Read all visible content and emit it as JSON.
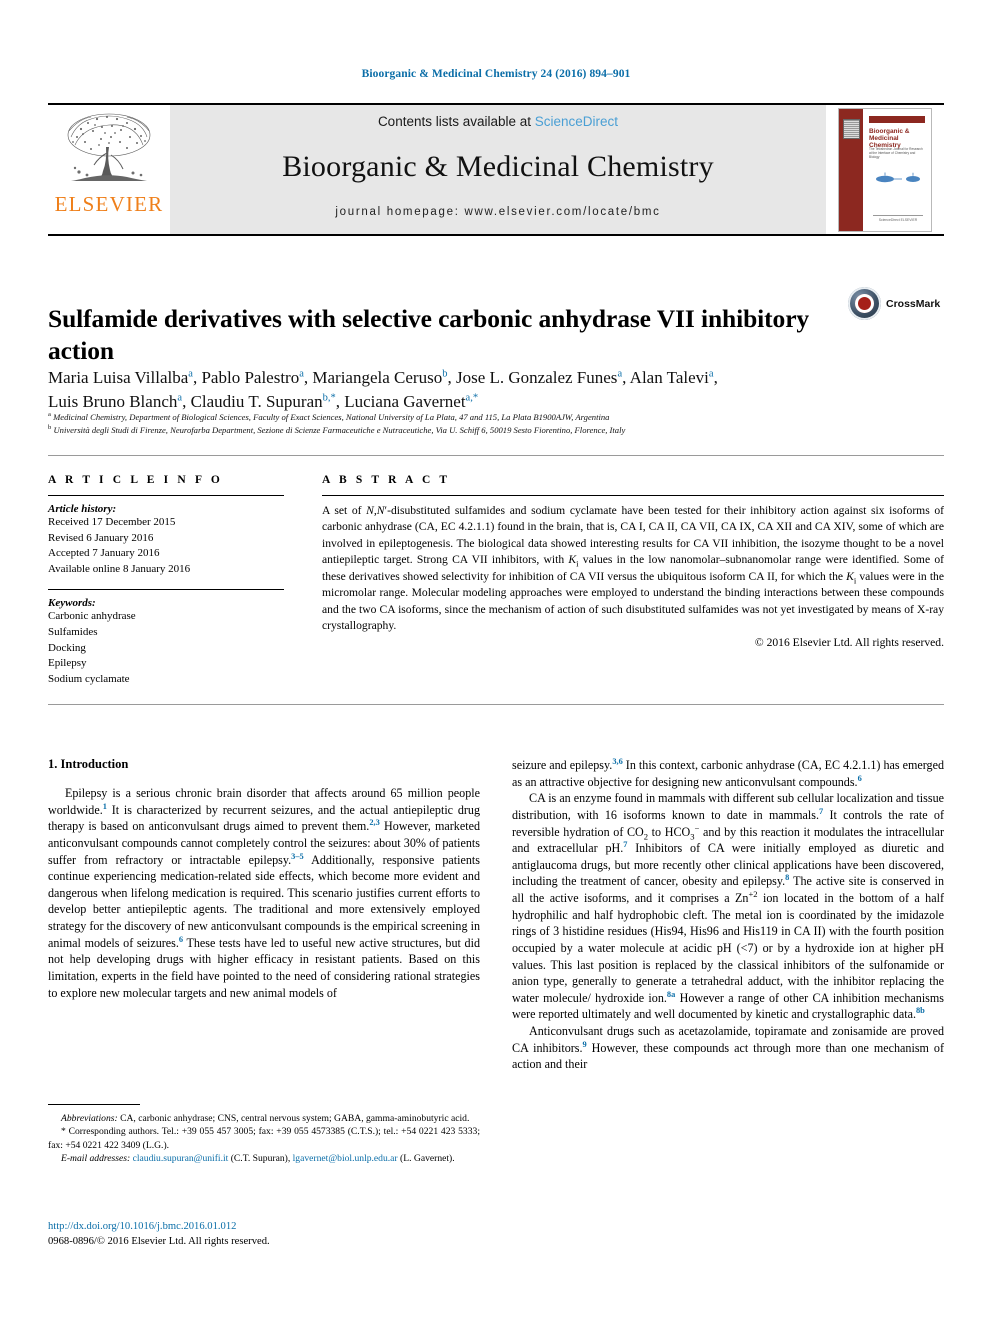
{
  "running_head": "Bioorganic & Medicinal Chemistry 24 (2016) 894–901",
  "masthead": {
    "contents_prefix": "Contents lists available at ",
    "sciencedirect": "ScienceDirect",
    "journal_title": "Bioorganic & Medicinal Chemistry",
    "homepage": "journal homepage: www.elsevier.com/locate/bmc",
    "publisher_logo_word": "ELSEVIER",
    "cover": {
      "title": "Bioorganic & Medicinal Chemistry",
      "subtitle": "The Tetrahedron Journal for Research at the Interface of Chemistry and Biology",
      "footer": "ScienceDirect  ELSEVIER"
    }
  },
  "article": {
    "title": "Sulfamide derivatives with selective carbonic anhydrase VII inhibitory action",
    "crossmark_label": "CrossMark",
    "authors_line1": "Maria Luisa Villalba a, Pablo Palestro a, Mariangela Ceruso b, Jose L. Gonzalez Funes a, Alan Talevi a,",
    "authors_line2": "Luis Bruno Blanch a, Claudiu T. Supuran b,*, Luciana Gavernet a,*",
    "authors": [
      {
        "name": "Maria Luisa Villalba",
        "mark": "a"
      },
      {
        "name": "Pablo Palestro",
        "mark": "a"
      },
      {
        "name": "Mariangela Ceruso",
        "mark": "b"
      },
      {
        "name": "Jose L. Gonzalez Funes",
        "mark": "a"
      },
      {
        "name": "Alan Talevi",
        "mark": "a"
      },
      {
        "name": "Luis Bruno Blanch",
        "mark": "a"
      },
      {
        "name": "Claudiu T. Supuran",
        "mark": "b,*"
      },
      {
        "name": "Luciana Gavernet",
        "mark": "a,*"
      }
    ],
    "affiliations": [
      {
        "mark": "a",
        "text": "Medicinal Chemistry, Department of Biological Sciences, Faculty of Exact Sciences, National University of La Plata, 47 and 115, La Plata B1900AJW, Argentina"
      },
      {
        "mark": "b",
        "text": "Università degli Studi di Firenze, Neurofarba Department, Sezione di Scienze Farmaceutiche e Nutraceutiche, Via U. Schiff 6, 50019 Sesto Fiorentino, Florence, Italy"
      }
    ]
  },
  "article_info": {
    "heading": "A R T I C L E   I N F O",
    "history_label": "Article history:",
    "history": [
      "Received 17 December 2015",
      "Revised 6 January 2016",
      "Accepted 7 January 2016",
      "Available online 8 January 2016"
    ],
    "keywords_label": "Keywords:",
    "keywords": [
      "Carbonic anhydrase",
      "Sulfamides",
      "Docking",
      "Epilepsy",
      "Sodium cyclamate"
    ]
  },
  "abstract": {
    "heading": "A B S T R A C T",
    "part1": "A set of ",
    "italic1": "N,N",
    "part2": "′-disubstituted sulfamides and sodium cyclamate have been tested for their inhibitory action against six isoforms of carbonic anhydrase (CA, EC 4.2.1.1) found in the brain, that is, CA I, CA II, CA VII, CA IX, CA XII and CA XIV, some of which are involved in epileptogenesis. The biological data showed interesting results for CA VII inhibition, the isozyme thought to be a novel antiepileptic target. Strong CA VII inhibitors, with ",
    "italic2": "K",
    "sub2": "i",
    "part3": " values in the low nanomolar–subnanomolar range were identified. Some of these derivatives showed selectivity for inhibition of CA VII versus the ubiquitous isoform CA II, for which the ",
    "italic3": "K",
    "sub3": "i",
    "part4": " values were in the micromolar range. Molecular modeling approaches were employed to understand the binding interactions between these compounds and the two CA isoforms, since the mechanism of action of such disubstituted sulfamides was not yet investigated by means of X-ray crystallography.",
    "copyright": "© 2016 Elsevier Ltd. All rights reserved."
  },
  "body": {
    "section_heading": "1. Introduction",
    "left_p1_a": "Epilepsy is a serious chronic brain disorder that affects around 65 million people worldwide.",
    "left_p1_r1": "1",
    "left_p1_b": " It is characterized by recurrent seizures, and the actual antiepileptic drug therapy is based on anticonvulsant drugs aimed to prevent them.",
    "left_p1_r2": "2,3",
    "left_p1_c": " However, marketed anticonvulsant compounds cannot completely control the seizures: about 30% of patients suffer from refractory or intractable epilepsy.",
    "left_p1_r3": "3–5",
    "left_p1_d": " Additionally, responsive patients continue experiencing medication-related side effects, which become more evident and dangerous when lifelong medication is required. This scenario justifies current efforts to develop better antiepileptic agents. The traditional and more extensively employed strategy for the discovery of new anticonvulsant compounds is the empirical screening in animal models of seizures.",
    "left_p1_r4": "6",
    "left_p1_e": " These tests have led to useful new active structures, but did not help developing drugs with higher efficacy in resistant patients. Based on this limitation, experts in the field have pointed to the need of considering rational strategies to explore new molecular targets and new animal models of",
    "right_p1_a": "seizure and epilepsy.",
    "right_p1_r1": "3,6",
    "right_p1_b": " In this context, carbonic anhydrase (CA, EC 4.2.1.1) has emerged as an attractive objective for designing new anticonvulsant compounds.",
    "right_p1_r2": "6",
    "right_p2_a": "CA is an enzyme found in mammals with different sub cellular localization and tissue distribution, with 16 isoforms known to date in mammals.",
    "right_p2_r1": "7",
    "right_p2_b": " It controls the rate of reversible hydration of CO",
    "right_p2_sub1": "2",
    "right_p2_c": " to HCO",
    "right_p2_sub2": "3",
    "right_p2_sup2": "−",
    "right_p2_d": " and by this reaction it modulates the intracellular and extracellular pH.",
    "right_p2_r2": "7",
    "right_p2_e": " Inhibitors of CA were initially employed as diuretic and antiglaucoma drugs, but more recently other clinical applications have been discovered, including the treatment of cancer, obesity and epilepsy.",
    "right_p2_r3": "8",
    "right_p2_f": " The active site is conserved in all the active isoforms, and it comprises a Zn",
    "right_p2_sup3": "+2",
    "right_p2_g": " ion located in the bottom of a half hydrophilic and half hydrophobic cleft. The metal ion is coordinated by the imidazole rings of 3 histidine residues (His94, His96 and His119 in CA II) with the fourth position occupied by a water molecule at acidic pH (<7) or by a hydroxide ion at higher pH values. This last position is replaced by the classical inhibitors of the sulfonamide or anion type, generally to generate a tetrahedral adduct, with the inhibitor replacing the water molecule/ hydroxide ion.",
    "right_p2_r4": "8a",
    "right_p2_h": " However a range of other CA inhibition mechanisms were reported ultimately and well documented by kinetic and crystallographic data.",
    "right_p2_r5": "8b",
    "right_p3_a": "Anticonvulsant drugs such as acetazolamide, topiramate and zonisamide are proved CA inhibitors.",
    "right_p3_r1": "9",
    "right_p3_b": " However, these compounds act through more than one mechanism of action and their"
  },
  "footnotes": {
    "abbrev_label": "Abbreviations:",
    "abbrev_text": " CA, carbonic anhydrase; CNS, central nervous system; GABA, gamma-aminobutyric acid.",
    "corresponding": "* Corresponding authors. Tel.: +39 055 457 3005; fax: +39 055 4573385 (C.T.S.); tel.: +54 0221 423 5333; fax: +54 0221 422 3409 (L.G.).",
    "email_label": "E-mail addresses:",
    "email1": "claudiu.supuran@unifi.it",
    "email1_owner": " (C.T. Supuran), ",
    "email2": "lgavernet@biol.unlp.edu.ar",
    "email2_owner": " (L. Gavernet)."
  },
  "footer": {
    "doi": "http://dx.doi.org/10.1016/j.bmc.2016.01.012",
    "issn": "0968-0896/© 2016 Elsevier Ltd. All rights reserved."
  },
  "colors": {
    "link_blue": "#0b6ea8",
    "sciencedirect_blue": "#4a9fd4",
    "elsevier_orange": "#ef7f1a",
    "cover_maroon": "#8c2820",
    "masthead_gray": "#e7e7e7"
  }
}
